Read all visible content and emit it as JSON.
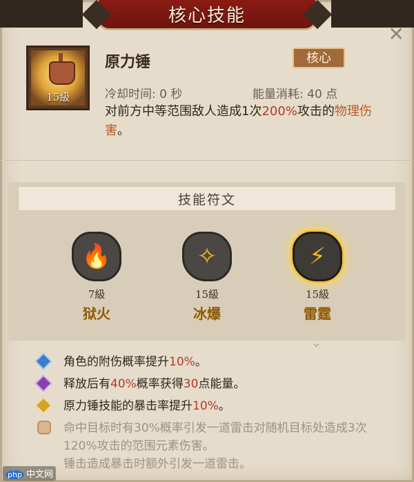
{
  "header": {
    "title": "核心技能"
  },
  "skill": {
    "name": "原力锤",
    "tag": "核心",
    "level": "15級",
    "cooldown": "冷却时间: 0 秒",
    "energy": "能量消耗: 40 点",
    "desc_parts": [
      "对前方中等范围敌人造成1次",
      "200%",
      "攻击的",
      "物理伤害",
      "。"
    ]
  },
  "runes": {
    "header": "技能符文",
    "items": [
      {
        "level": "7級",
        "name": "狱火",
        "icon": "flame-icon"
      },
      {
        "level": "15級",
        "name": "冰爆",
        "icon": "ice-burst-icon"
      },
      {
        "level": "15級",
        "name": "雷霆",
        "icon": "thunder-icon",
        "selected": true
      }
    ]
  },
  "effects": [
    {
      "parts": [
        "角色的附伤概率提升",
        "10%",
        "。"
      ],
      "icon": "blue-diamond-icon",
      "color": "#3d7fc7"
    },
    {
      "parts": [
        "释放后有",
        "40%",
        "概率获得",
        "30",
        "点能量。"
      ],
      "icon": "purple-diamond-icon",
      "color": "#8a3fb0"
    },
    {
      "parts": [
        "原力锤技能的暴击率提升",
        "10%",
        "。"
      ],
      "icon": "gold-diamond-icon",
      "color": "#d2a229"
    },
    {
      "parts": [
        "命中目标时有30%概率引发一道雷击对随机目标处造成3次120%攻击的范围元素伤害。",
        "锤击造成暴击时额外引发一道雷击。"
      ],
      "icon": "pot-icon"
    }
  ],
  "watermark": {
    "badge": "php",
    "text": "中文网"
  }
}
